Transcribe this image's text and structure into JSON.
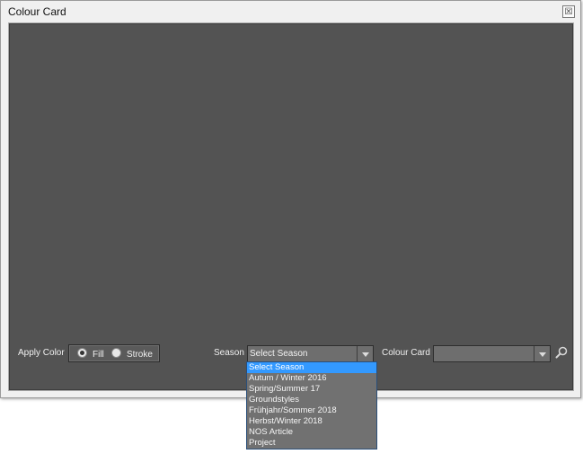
{
  "window": {
    "title": "Colour Card",
    "close_glyph": "☒"
  },
  "apply_color": {
    "label": "Apply Color",
    "options": [
      {
        "label": "Fill",
        "selected": true
      },
      {
        "label": "Stroke",
        "selected": false
      }
    ]
  },
  "season": {
    "label": "Season",
    "selected": "Select Season",
    "options": [
      "Select Season",
      "Autum / Winter 2016",
      "Spring/Summer 17",
      "Groundstyles",
      "Frühjahr/Sommer 2018",
      "Herbst/Winter 2018",
      "NOS Article",
      "Project"
    ]
  },
  "colour_card": {
    "label": "Colour Card",
    "selected": ""
  },
  "icons": {
    "search": "search-icon",
    "dropdown_arrow": "chevron-down-icon"
  },
  "colors": {
    "panel": "#535353",
    "highlight": "#3399ff",
    "dropdown_bg": "#717171"
  }
}
